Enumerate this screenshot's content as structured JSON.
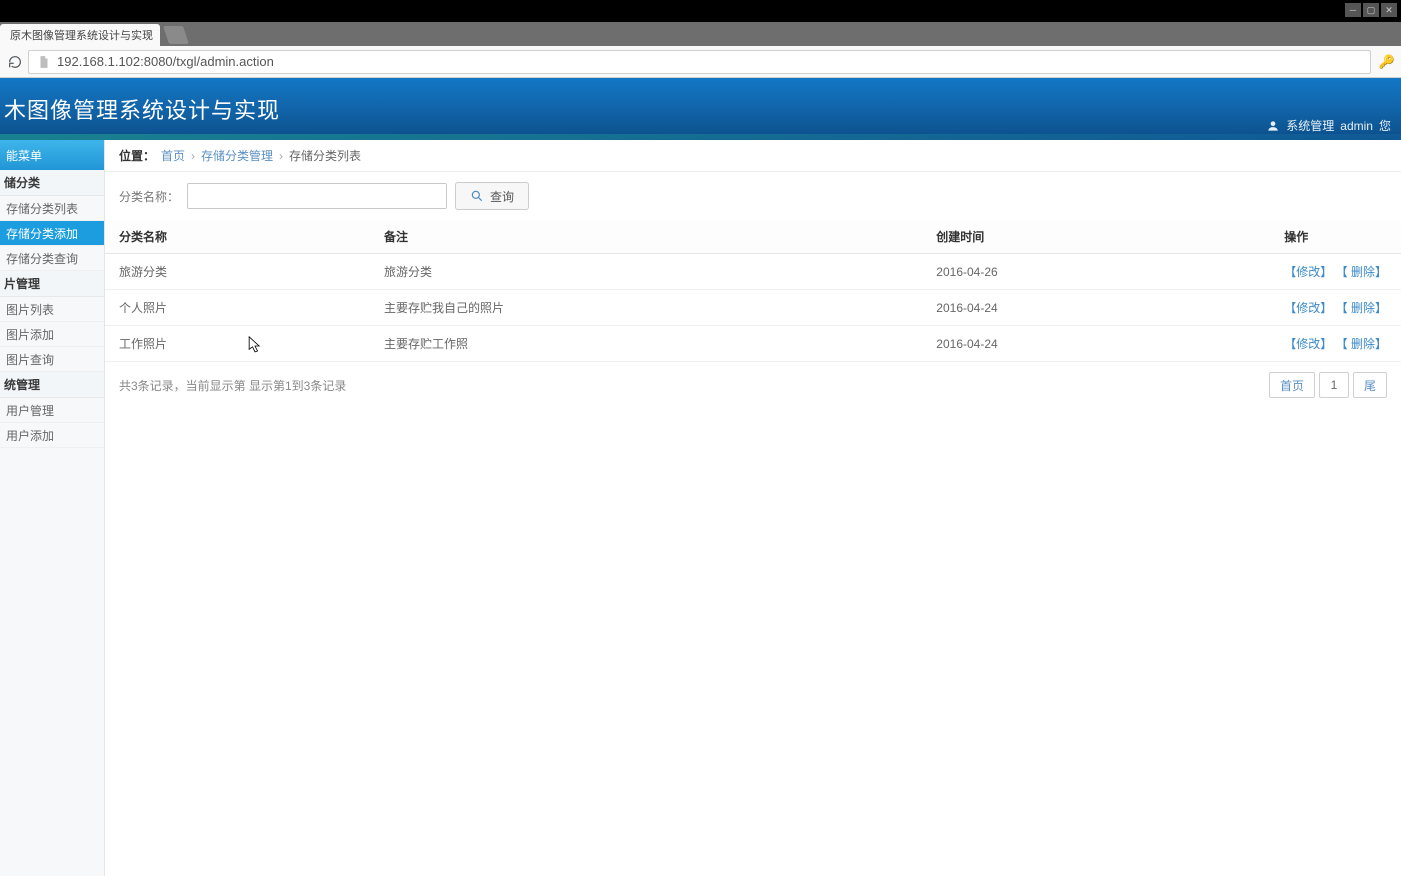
{
  "browser": {
    "tab_title": "原木图像管理系统设计与实现",
    "url": "192.168.1.102:8080/txgl/admin.action"
  },
  "header": {
    "title": "木图像管理系统设计与实现",
    "user_prefix": "系统管理",
    "user_name": "admin",
    "user_suffix": "您"
  },
  "sidebar": {
    "head": "能菜单",
    "groups": [
      {
        "title": "储分类",
        "items": [
          {
            "label": "存储分类列表",
            "active": false
          },
          {
            "label": "存储分类添加",
            "active": true
          },
          {
            "label": "存储分类查询",
            "active": false
          }
        ]
      },
      {
        "title": "片管理",
        "items": [
          {
            "label": "图片列表",
            "active": false
          },
          {
            "label": "图片添加",
            "active": false
          },
          {
            "label": "图片查询",
            "active": false
          }
        ]
      },
      {
        "title": "统管理",
        "items": [
          {
            "label": "用户管理",
            "active": false
          },
          {
            "label": "用户添加",
            "active": false
          }
        ]
      }
    ]
  },
  "breadcrumb": {
    "label": "位置：",
    "parts": [
      "首页",
      "存储分类管理",
      "存储分类列表"
    ]
  },
  "search": {
    "label": "分类名称：",
    "value": "",
    "button": "查询"
  },
  "table": {
    "columns": [
      "分类名称",
      "备注",
      "创建时间",
      "操作"
    ],
    "rows": [
      {
        "name": "旅游分类",
        "remark": "旅游分类",
        "date": "2016-04-26"
      },
      {
        "name": "个人照片",
        "remark": "主要存贮我自己的照片",
        "date": "2016-04-24"
      },
      {
        "name": "工作照片",
        "remark": "主要存贮工作照",
        "date": "2016-04-24"
      }
    ],
    "action_edit": "【修改】",
    "action_delete": "【 删除】"
  },
  "pager": {
    "info": "共3条记录，当前显示第   显示第1到3条记录",
    "first": "首页",
    "current": "1",
    "last": "尾"
  }
}
